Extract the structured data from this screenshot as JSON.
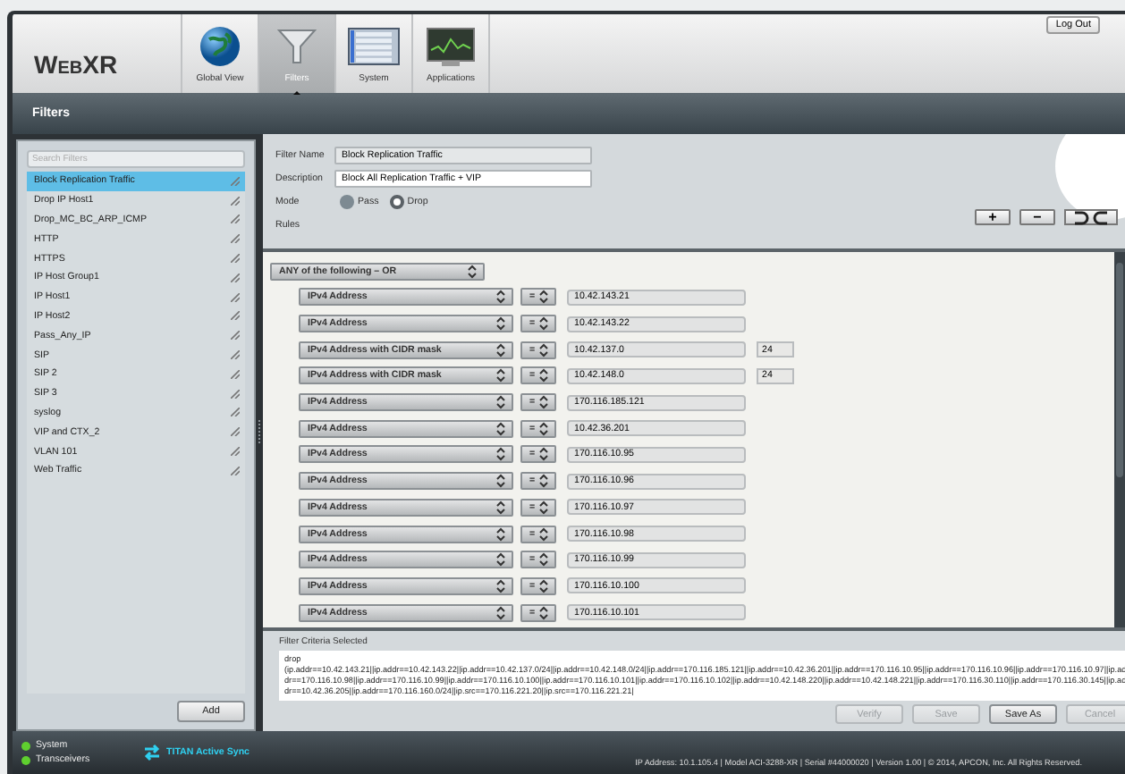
{
  "app": {
    "logo": "WebXR",
    "logout": "Log Out"
  },
  "nav_tabs": [
    {
      "label": "Global View",
      "selected": false
    },
    {
      "label": "Filters",
      "selected": true
    },
    {
      "label": "System",
      "selected": false
    },
    {
      "label": "Applications",
      "selected": false
    }
  ],
  "page_title": "Filters",
  "sidebar": {
    "search_placeholder": "Search Filters",
    "add_button": "Add",
    "items": [
      {
        "label": "Block Replication Traffic",
        "selected": true
      },
      {
        "label": "Drop IP Host1",
        "selected": false
      },
      {
        "label": "Drop_MC_BC_ARP_ICMP",
        "selected": false
      },
      {
        "label": "HTTP",
        "selected": false
      },
      {
        "label": "HTTPS",
        "selected": false
      },
      {
        "label": "IP Host Group1",
        "selected": false
      },
      {
        "label": "IP Host1",
        "selected": false
      },
      {
        "label": "IP Host2",
        "selected": false
      },
      {
        "label": "Pass_Any_IP",
        "selected": false
      },
      {
        "label": "SIP",
        "selected": false
      },
      {
        "label": "SIP 2",
        "selected": false
      },
      {
        "label": "SIP 3",
        "selected": false
      },
      {
        "label": "syslog",
        "selected": false
      },
      {
        "label": "VIP and CTX_2",
        "selected": false
      },
      {
        "label": "VLAN 101",
        "selected": false
      },
      {
        "label": "Web Traffic",
        "selected": false
      }
    ]
  },
  "form": {
    "filter_name_label": "Filter Name",
    "filter_name": "Block Replication Traffic",
    "description_label": "Description",
    "description": "Block All Replication Traffic + VIP",
    "mode_label": "Mode",
    "modes": [
      {
        "label": "Pass",
        "selected": false
      },
      {
        "label": "Drop",
        "selected": true
      }
    ],
    "rules_label": "Rules",
    "toolbar": [
      "+",
      "−"
    ]
  },
  "rules": {
    "group": "ANY of the following – OR",
    "rows": [
      {
        "field": "IPv4 Address",
        "op": "=",
        "value": "10.42.143.21"
      },
      {
        "field": "IPv4 Address",
        "op": "=",
        "value": "10.42.143.22"
      },
      {
        "field": "IPv4 Address with CIDR mask",
        "op": "=",
        "value": "10.42.137.0",
        "mask": "24"
      },
      {
        "field": "IPv4 Address with CIDR mask",
        "op": "=",
        "value": "10.42.148.0",
        "mask": "24"
      },
      {
        "field": "IPv4 Address",
        "op": "=",
        "value": "170.116.185.121"
      },
      {
        "field": "IPv4 Address",
        "op": "=",
        "value": "10.42.36.201"
      },
      {
        "field": "IPv4 Address",
        "op": "=",
        "value": "170.116.10.95"
      },
      {
        "field": "IPv4 Address",
        "op": "=",
        "value": "170.116.10.96"
      },
      {
        "field": "IPv4 Address",
        "op": "=",
        "value": "170.116.10.97"
      },
      {
        "field": "IPv4 Address",
        "op": "=",
        "value": "170.116.10.98"
      },
      {
        "field": "IPv4 Address",
        "op": "=",
        "value": "170.116.10.99"
      },
      {
        "field": "IPv4 Address",
        "op": "=",
        "value": "170.116.10.100"
      },
      {
        "field": "IPv4 Address",
        "op": "=",
        "value": "170.116.10.101"
      }
    ]
  },
  "criteria": {
    "label": "Filter Criteria Selected",
    "text": "drop\n(ip.addr==10.42.143.21||ip.addr==10.42.143.22||ip.addr==10.42.137.0/24||ip.addr==10.42.148.0/24||ip.addr==170.116.185.121||ip.addr==10.42.36.201||ip.addr==170.116.10.95||ip.addr==170.116.10.96||ip.addr==170.116.10.97||ip.addr==170.116.10.98||ip.addr==170.116.10.99||ip.addr==170.116.10.100||ip.addr==170.116.10.101||ip.addr==170.116.10.102||ip.addr==10.42.148.220||ip.addr==10.42.148.221||ip.addr==170.116.30.110||ip.addr==170.116.30.145||ip.addr==10.42.36.205||ip.addr==170.116.160.0/24||ip.src==170.116.221.20||ip.src==170.116.221.21|"
  },
  "actions": [
    {
      "label": "Verify",
      "disabled": true
    },
    {
      "label": "Save",
      "disabled": true
    },
    {
      "label": "Save As",
      "disabled": false
    },
    {
      "label": "Cancel",
      "disabled": true
    }
  ],
  "status_bar": {
    "indicators": [
      {
        "label": "System",
        "color": "#5fcf2f"
      },
      {
        "label": "Transceivers",
        "color": "#5fcf2f"
      }
    ],
    "sync": "TITAN Active Sync",
    "info": "IP Address: 10.1.105.4 | Model ACI-3288-XR | Serial #44000020 | Version 1.00 | © 2014, APCON, Inc. All Rights Reserved."
  }
}
